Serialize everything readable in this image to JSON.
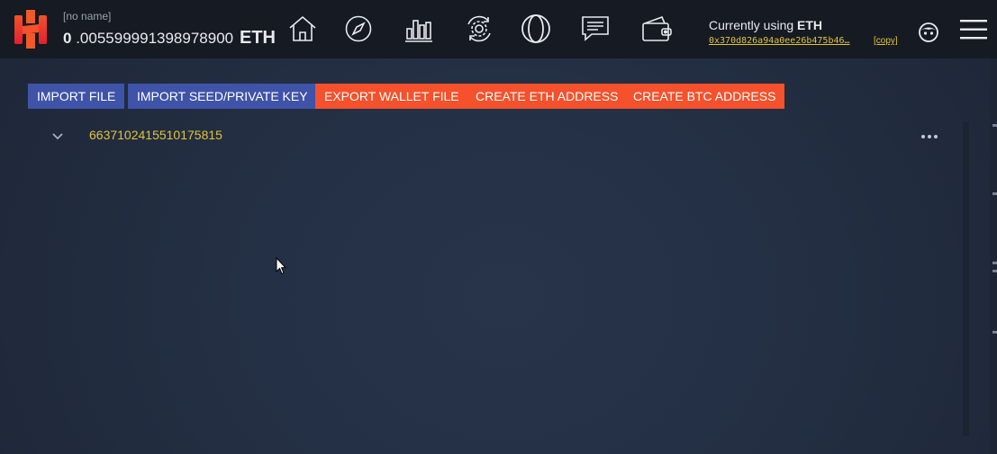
{
  "header": {
    "wallet_name": "[no name]",
    "balance_int": "0",
    "balance_frac": ".005599991398978900",
    "currency": "ETH",
    "using_prefix": "Currently using ",
    "using_currency": "ETH",
    "address": "0x370d826a94a0ee26b475b46…",
    "copy_label": "[copy]"
  },
  "nav": [
    {
      "name": "home",
      "icon": "home-icon"
    },
    {
      "name": "explore",
      "icon": "compass-icon"
    },
    {
      "name": "charts",
      "icon": "bar-chart-icon"
    },
    {
      "name": "exchange",
      "icon": "refresh-gear-icon"
    },
    {
      "name": "circles",
      "icon": "double-circle-icon"
    },
    {
      "name": "messages",
      "icon": "chat-icon"
    },
    {
      "name": "wallet",
      "icon": "wallet-icon"
    }
  ],
  "actions": {
    "import_file": "IMPORT FILE",
    "import_seed": "IMPORT SEED/PRIVATE KEY",
    "export_wallet": "EXPORT WALLET FILE",
    "create_eth": "CREATE ETH ADDRESS",
    "create_btc": "CREATE BTC ADDRESS"
  },
  "wallets": [
    {
      "id": "6637102415510175815"
    }
  ],
  "colors": {
    "accent_blue": "#3f53a8",
    "accent_orange": "#f4512c",
    "link_yellow": "#e0c43a",
    "topbar_bg": "#151a23",
    "page_bg": "#243045"
  }
}
